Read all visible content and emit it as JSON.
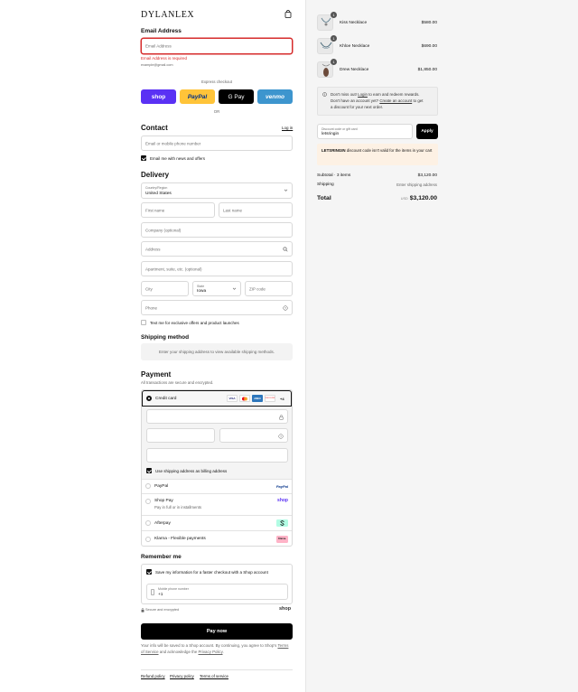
{
  "brand": {
    "logo": "DYLANLEX"
  },
  "email_section": {
    "title": "Email Address",
    "placeholder": "Email Address",
    "error": "Email Address is required",
    "hint": "example@gmail.com"
  },
  "express": {
    "label": "Express checkout",
    "buttons": [
      "shop",
      "PayPal",
      "G Pay",
      "venmo"
    ],
    "or": "OR"
  },
  "contact": {
    "title": "Contact",
    "login": "Log in",
    "placeholder": "Email or mobile phone number",
    "news_label": "Email me with news and offers"
  },
  "delivery": {
    "title": "Delivery",
    "country_label": "Country/Region",
    "country_value": "United States",
    "first_name": "First name",
    "last_name": "Last name",
    "company": "Company (optional)",
    "address": "Address",
    "apartment": "Apartment, suite, etc. (optional)",
    "city": "City",
    "state_label": "State",
    "state_value": "Iowa",
    "zip": "ZIP code",
    "phone": "Phone",
    "text_offers": "Text me for exclusive offers and product launches"
  },
  "shipping": {
    "title": "Shipping method",
    "note": "Enter your shipping address to view available shipping methods."
  },
  "payment": {
    "title": "Payment",
    "subtitle": "All transactions are secure and encrypted.",
    "credit_card": "Credit card",
    "card_icons": [
      "VISA",
      "MC",
      "AMEX",
      "DISCOVER",
      "+4"
    ],
    "billing_same": "Use shipping address as billing address",
    "methods": [
      {
        "name": "PayPal",
        "sub": "",
        "logo": "PayPal"
      },
      {
        "name": "Shop Pay",
        "sub": "Pay in full or in installments",
        "logo": "shop"
      },
      {
        "name": "Afterpay",
        "sub": "",
        "logo": ""
      },
      {
        "name": "Klarna - Flexible payments",
        "sub": "",
        "logo": "Klarna."
      }
    ]
  },
  "remember": {
    "title": "Remember me",
    "save_label": "Save my information for a faster checkout with a Shop account",
    "phone_label": "Mobile phone number",
    "phone_value": "+1",
    "secure": "Secure and encrypted",
    "shop": "shop"
  },
  "pay_now": "Pay now",
  "legal": {
    "text1": "Your info will be saved to a Shop account. By continuing, you agree to Shop's",
    "tos": "Terms of Service",
    "text2": "and acknowledge the",
    "privacy": "Privacy Policy",
    "end": "."
  },
  "footer": [
    "Refund policy",
    "Privacy policy",
    "Terms of service"
  ],
  "cart": {
    "items": [
      {
        "name": "Kiss Necklace",
        "price": "$580.00",
        "qty": "1"
      },
      {
        "name": "Khloe Necklace",
        "price": "$690.00",
        "qty": "1"
      },
      {
        "name": "Drew Necklace",
        "price": "$1,850.00",
        "qty": "1"
      }
    ],
    "rewards": {
      "t1": "Don't miss out!",
      "login": "Login",
      "t2": "to earn and redeem rewards.",
      "t3": "Don't have an account yet?",
      "create": "Create an account",
      "t4": "to get",
      "t5": "a discount for your next order."
    },
    "discount_label": "Discount code or gift card",
    "discount_value": "letsringin",
    "apply": "Apply",
    "error_code": "LETSRINGIN",
    "error_msg": "discount code isn't valid for the items in your cart",
    "subtotal_label": "Subtotal · 3 items",
    "subtotal": "$3,120.00",
    "shipping_label": "Shipping",
    "shipping_value": "Enter shipping address",
    "total_label": "Total",
    "currency": "USD",
    "total": "$3,120.00"
  }
}
